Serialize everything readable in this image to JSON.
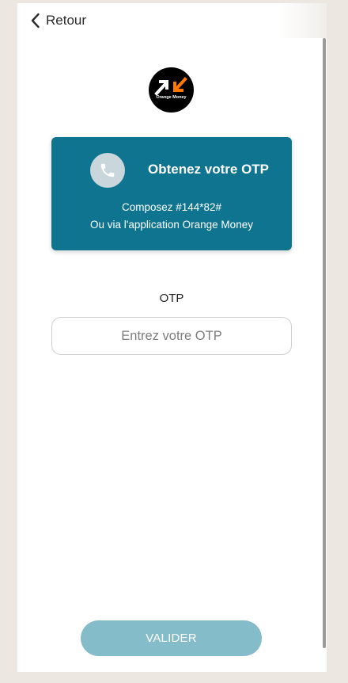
{
  "header": {
    "back_label": "Retour",
    "back_icon": "chevron-left-icon"
  },
  "logo": {
    "text": "Orange Money",
    "colors": {
      "background": "#000000",
      "arrow_white": "#ffffff",
      "arrow_orange": "#ff7900"
    }
  },
  "otp_card": {
    "title": "Obtenez votre OTP",
    "line1": "Composez #144*82#",
    "line2": "Ou via l'application Orange Money",
    "icon": "phone-icon",
    "background_color": "#0f7490"
  },
  "form": {
    "otp_label": "OTP",
    "otp_placeholder": "Entrez votre OTP",
    "otp_value": ""
  },
  "actions": {
    "submit_label": "VALIDER",
    "submit_color": "#85bcc9"
  }
}
